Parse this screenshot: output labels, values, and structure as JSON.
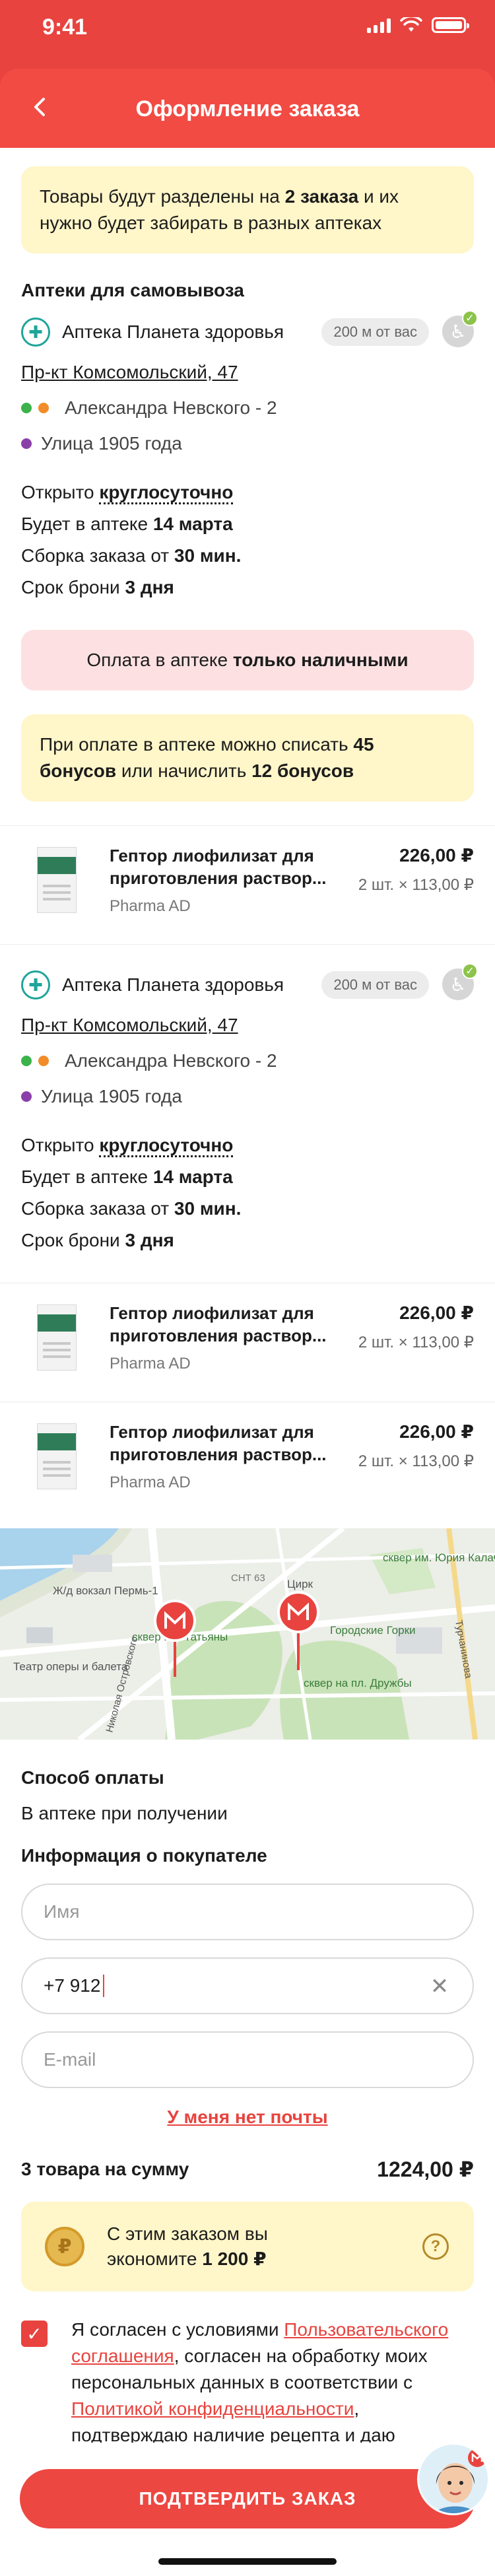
{
  "status_bar": {
    "time": "9:41"
  },
  "header": {
    "title": "Оформление заказа"
  },
  "split_banner": {
    "text_a": "Товары будут разделены на ",
    "text_b": "2 заказа",
    "text_c": " и их нужно будет забирать в разных аптеках"
  },
  "pickup_title": "Аптеки для самовывоза",
  "pharmacies": [
    {
      "name": "Аптека Планета здоровья",
      "distance": "200 м от вас",
      "address": "Пр-кт Комсомольский, 47",
      "metro": [
        {
          "label": "Александра Невского - 2",
          "colors": [
            "#3cb24a",
            "#f28c28"
          ]
        },
        {
          "label": "Улица 1905 года",
          "colors": [
            "#8b3fa8"
          ]
        }
      ],
      "open_label": "Открыто ",
      "open_value": "круглосуточно",
      "arrival_label": "Будет в аптеке ",
      "arrival_value": "14 марта",
      "assembly_label": "Сборка заказа от ",
      "assembly_value": "30 мин.",
      "reserve_label": "Срок брони ",
      "reserve_value": "3 дня"
    },
    {
      "name": "Аптека Планета здоровья",
      "distance": "200 м от вас",
      "address": "Пр-кт Комсомольский, 47",
      "metro": [
        {
          "label": "Александра Невского - 2",
          "colors": [
            "#3cb24a",
            "#f28c28"
          ]
        },
        {
          "label": "Улица 1905 года",
          "colors": [
            "#8b3fa8"
          ]
        }
      ],
      "open_label": "Открыто ",
      "open_value": "круглосуточно",
      "arrival_label": "Будет в аптеке ",
      "arrival_value": "14 марта",
      "assembly_label": "Сборка заказа от ",
      "assembly_value": "30 мин.",
      "reserve_label": "Срок брони ",
      "reserve_value": "3 дня"
    }
  ],
  "cash_banner": {
    "text_a": "Оплата в аптеке ",
    "text_b": "только наличными"
  },
  "bonus_banner": {
    "text_a": "При оплате в аптеке можно списать ",
    "text_b": "45 бонусов",
    "text_c": " или начислить ",
    "text_d": "12 бонусов"
  },
  "products": [
    {
      "name": "Гептор лиофилизат для приготовления раствор...",
      "brand": "Pharma AD",
      "total": "226,00 ₽",
      "unit": "2 шт. × 113,00 ₽"
    },
    {
      "name": "Гептор лиофилизат для приготовления раствор...",
      "brand": "Pharma AD",
      "total": "226,00 ₽",
      "unit": "2 шт. × 113,00 ₽"
    },
    {
      "name": "Гептор лиофилизат для приготовления раствор...",
      "brand": "Pharma AD",
      "total": "226,00 ₽",
      "unit": "2 шт. × 113,00 ₽"
    }
  ],
  "map": {
    "labels": {
      "station": "Ж/д вокзал Пермь-1",
      "theatre": "Театр оперы и балета",
      "square1": "сквер им. Татьяны",
      "circus": "Цирк",
      "hill": "Городские Горки",
      "square2": "сквер им. Юрия Калачникова",
      "square3": "сквер на пл. Дружбы",
      "street1": "Турчанинова",
      "street2": "Николая Островского",
      "snt": "СНТ 63"
    }
  },
  "payment": {
    "title": "Способ оплаты",
    "value": "В аптеке при получении"
  },
  "buyer": {
    "title": "Информация о покупателе",
    "name_placeholder": "Имя",
    "phone_value": "+7 912",
    "email_placeholder": "E-mail",
    "no_email_link": "У меня нет почты"
  },
  "summary": {
    "label": "3 товара на сумму",
    "value": "1224,00 ₽"
  },
  "savings": {
    "text_a": "С этим заказом вы экономите ",
    "text_b": "1 200 ₽",
    "coin": "₽"
  },
  "agreement": {
    "t1": "Я согласен с условиями ",
    "link1": "Пользовательского соглашения",
    "t2": ", согласен на обработку моих персональных данных в соответствии с ",
    "link2": "Политикой конфиденциальности",
    "t3": ", подтверждаю наличие рецепта и даю согласие на получение sms-уведомлений о статусе заказа"
  },
  "confirm_button": "ПОДТВЕРДИТЬ ЗАКАЗ",
  "colors": {
    "accent": "#e8433e",
    "banner_yellow": "#fff6c9",
    "banner_pink": "#fde1e2",
    "pharmacy_green": "#1fa59a"
  }
}
